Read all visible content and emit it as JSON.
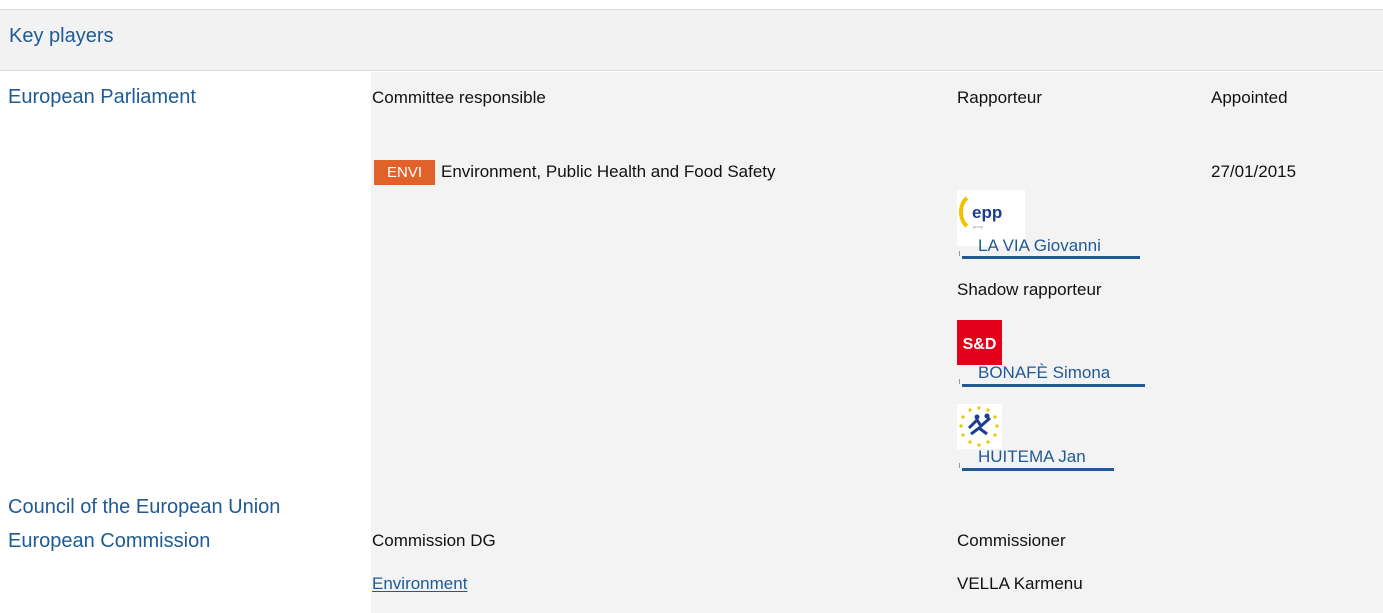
{
  "panel": {
    "title": "Key players"
  },
  "institutions": {
    "ep": "European Parliament",
    "council": "Council of the European Union",
    "commission": "European Commission"
  },
  "ep_table": {
    "col_committee": "Committee responsible",
    "col_rapporteur": "Rapporteur",
    "col_appointed": "Appointed",
    "committee_code": "ENVI",
    "committee_name": "Environment, Public Health and Food Safety",
    "appointed_date": "27/01/2015",
    "rapporteur": {
      "group_logo": "EPP",
      "name": "LA VIA Giovanni"
    },
    "shadow_label": "Shadow rapporteur",
    "shadows": [
      {
        "group_logo": "S&D",
        "name": "BONAFÈ Simona"
      },
      {
        "group_logo": "group-logo-icon",
        "name": "HUITEMA Jan"
      }
    ]
  },
  "commission_table": {
    "col_dg": "Commission DG",
    "col_commissioner": "Commissioner",
    "dg": "Environment",
    "commissioner": "VELLA Karmenu"
  },
  "colors": {
    "link": "#1f5a94",
    "badge": "#e0622a",
    "sd_red": "#e2001a"
  }
}
